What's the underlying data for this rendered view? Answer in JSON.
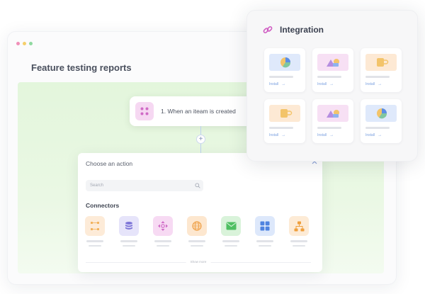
{
  "window": {
    "page_title": "Feature testing reports",
    "dots": [
      "#f08fb8",
      "#f5cf6a",
      "#8fd9a0"
    ]
  },
  "flow": {
    "trigger_label": "1. When an iteam is created",
    "add_step_symbol": "+"
  },
  "action_panel": {
    "title": "Choose an action",
    "search_placeholder": "Search",
    "connectors_title": "Connectors",
    "connectors": [
      {
        "icon": "grid-dots-icon",
        "bg": "#fdebd8",
        "fg": "#f2b15a"
      },
      {
        "icon": "database-icon",
        "bg": "#e6e4fa",
        "fg": "#7e76d8"
      },
      {
        "icon": "move-arrows-icon",
        "bg": "#f7daf3",
        "fg": "#d06bc6"
      },
      {
        "icon": "globe-icon",
        "bg": "#fde7cf",
        "fg": "#efa24a"
      },
      {
        "icon": "mail-icon",
        "bg": "#d9f3da",
        "fg": "#4fbf62"
      },
      {
        "icon": "apps-grid-icon",
        "bg": "#dde8fb",
        "fg": "#4f83e0"
      },
      {
        "icon": "hierarchy-icon",
        "bg": "#fdebd6",
        "fg": "#ef9f3c"
      }
    ],
    "show_more": "Show more"
  },
  "integration": {
    "title": "Integration",
    "install_label": "Install",
    "arrow": "→",
    "cards": [
      {
        "thumb": "pie-chart-thumb",
        "bg": "#dfe9fb"
      },
      {
        "thumb": "shapes-thumb",
        "bg": "#f7e0f4"
      },
      {
        "thumb": "cup-thumb",
        "bg": "#fde9d4"
      },
      {
        "thumb": "cup-thumb",
        "bg": "#fde9d4"
      },
      {
        "thumb": "shapes-thumb",
        "bg": "#f7e0f4"
      },
      {
        "thumb": "pie-chart-thumb",
        "bg": "#dfe9fb"
      }
    ]
  }
}
